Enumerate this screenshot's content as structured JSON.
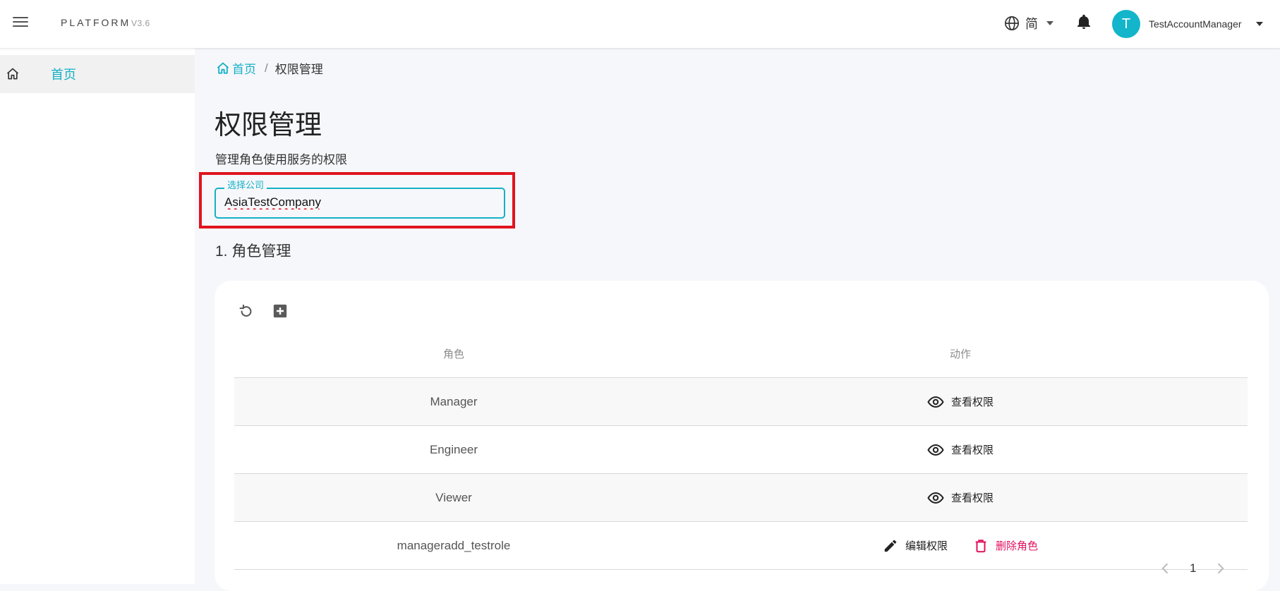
{
  "topbar": {
    "brand": "PLATFORM",
    "version": "V3.6",
    "language_label": "简",
    "user_initial": "T",
    "username": "TestAccountManager"
  },
  "sidebar": {
    "items": [
      {
        "label": "首页",
        "icon": "home-icon"
      }
    ]
  },
  "breadcrumb": {
    "home_label": "首页",
    "separator": "/",
    "current": "权限管理"
  },
  "page": {
    "title": "权限管理",
    "description": "管理角色使用服务的权限"
  },
  "company_select": {
    "legend": "选择公司",
    "value": "AsiaTestCompany"
  },
  "section": {
    "title": "1. 角色管理"
  },
  "table": {
    "headers": {
      "role": "角色",
      "action": "动作"
    },
    "rows": [
      {
        "role": "Manager",
        "actions": [
          {
            "label": "查看权限",
            "icon": "eye-icon"
          }
        ]
      },
      {
        "role": "Engineer",
        "actions": [
          {
            "label": "查看权限",
            "icon": "eye-icon"
          }
        ]
      },
      {
        "role": "Viewer",
        "actions": [
          {
            "label": "查看权限",
            "icon": "eye-icon"
          }
        ]
      },
      {
        "role": "manageradd_testrole",
        "actions": [
          {
            "label": "编辑权限",
            "icon": "pencil-icon"
          },
          {
            "label": "删除角色",
            "icon": "trash-icon"
          }
        ]
      }
    ]
  },
  "pagination": {
    "current_page": "1"
  },
  "colors": {
    "accent": "#14b1c6",
    "danger": "#e0125f",
    "highlight": "#e0141e"
  }
}
